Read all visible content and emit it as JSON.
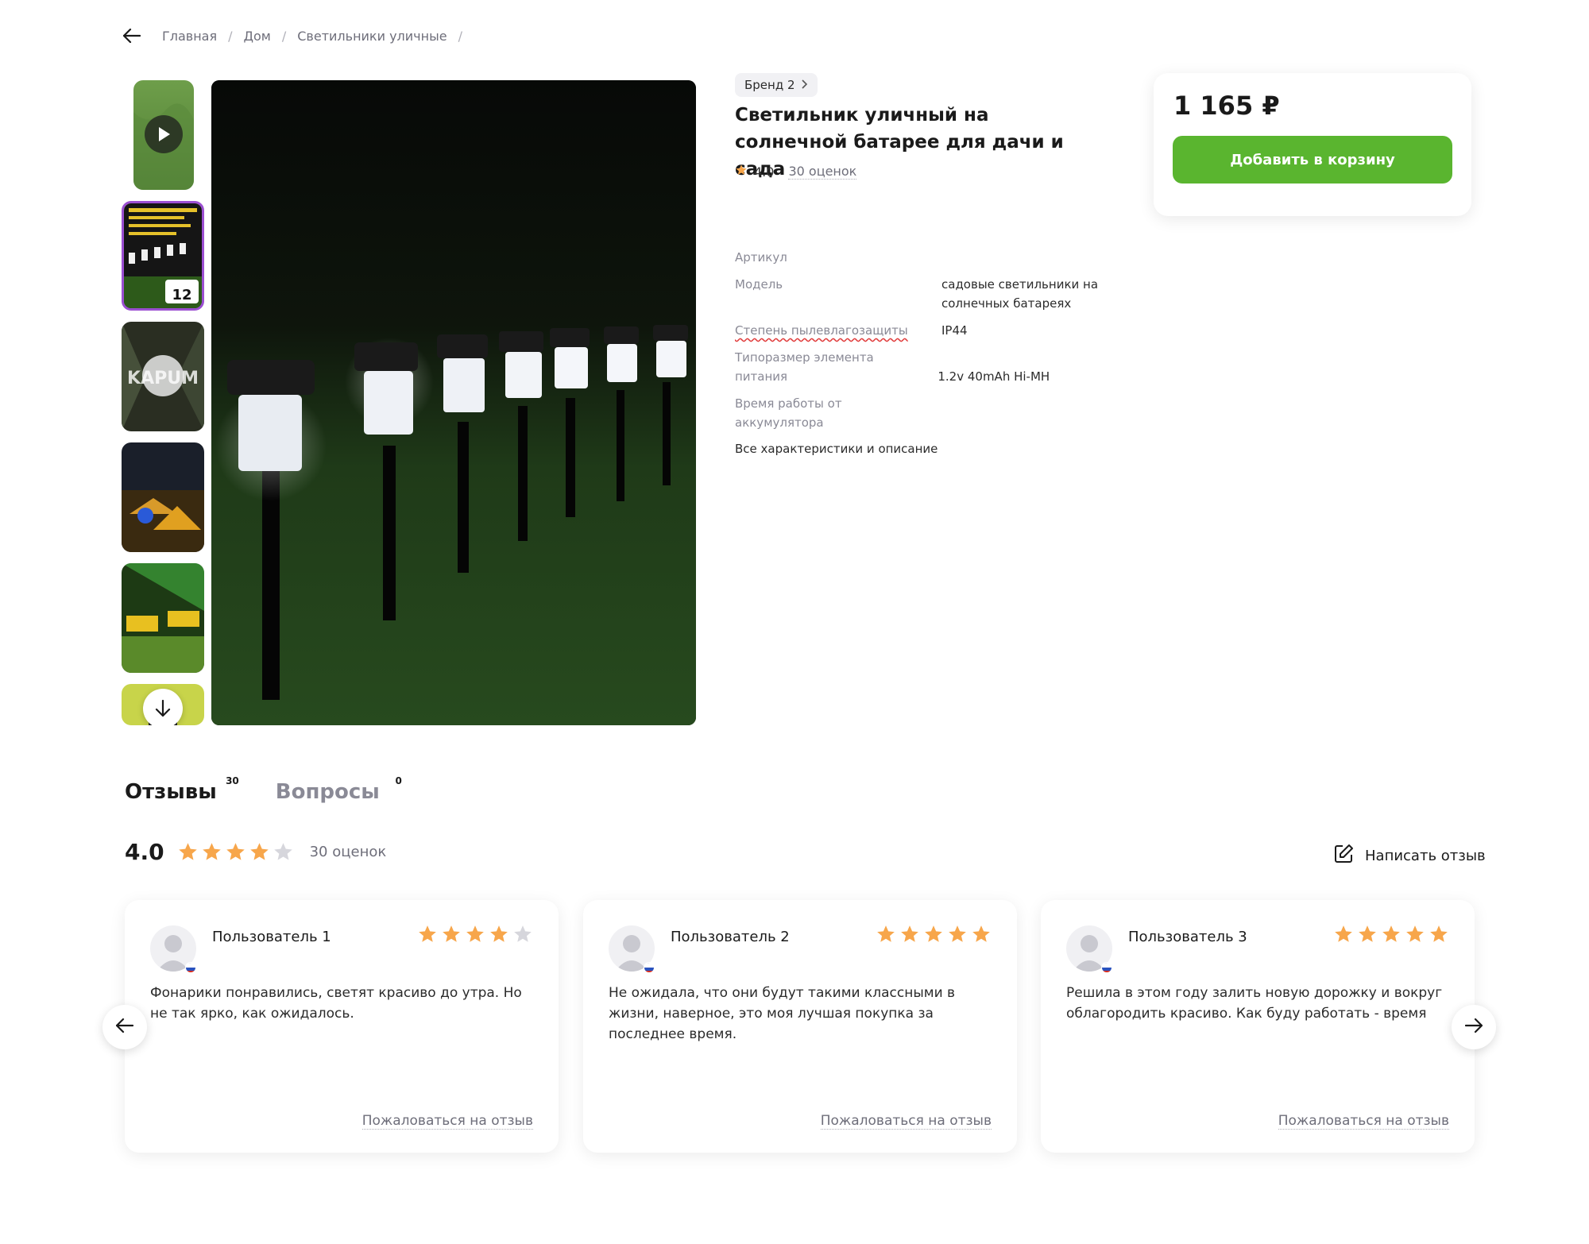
{
  "breadcrumb": {
    "items": [
      "Главная",
      "Дом",
      "Светильники уличные"
    ],
    "separator": "/"
  },
  "product": {
    "brand": "Бренд 2",
    "title": "Светильник уличный на солнечной батарее для дачи и сада",
    "rating": "4.0",
    "rating_count": "30 оценок",
    "specs": [
      {
        "key": "Артикул",
        "value": ""
      },
      {
        "key": "Модель",
        "value": "садовые светильники на солнечных батареях"
      },
      {
        "key": "Степень пылевлагозащиты",
        "value": "IP44"
      },
      {
        "key": "Типоразмер элемента питания",
        "value": "1.2v 40mAh Hi-MH"
      },
      {
        "key": "Время работы от аккумулятора",
        "value": ""
      }
    ],
    "all_specs_link": "Все характеристики и описание",
    "price": "1 165 ₽",
    "add_to_cart": "Добавить в корзину"
  },
  "gallery": {
    "thumb2_text_big": "12",
    "thumb3_watermark": "KAPUM"
  },
  "reviews_section": {
    "tabs": [
      {
        "label": "Отзывы",
        "count": "30"
      },
      {
        "label": "Вопросы",
        "count": "0"
      }
    ],
    "summary_score": "4.0",
    "summary_stars": 4,
    "summary_count": "30 оценок",
    "write_review": "Написать отзыв",
    "reviews": [
      {
        "user": "Пользователь 1",
        "stars": 4,
        "text": "Фонарики понравились, светят красиво до утра. Но не так ярко, как ожидалось.",
        "report": "Пожаловаться на отзыв"
      },
      {
        "user": "Пользователь 2",
        "stars": 5,
        "text": "Не ожидала, что они будут такими классными в жизни, наверное, это моя лучшая покупка за последнее время.",
        "report": "Пожаловаться на отзыв"
      },
      {
        "user": "Пользователь 3",
        "stars": 5,
        "text": "Решила в этом году залить новую дорожку и вокруг облагородить красиво. Как буду работать - время",
        "report": "Пожаловаться на отзыв"
      }
    ]
  },
  "colors": {
    "accent_green": "#5ab52f",
    "star_orange": "#f7a64b",
    "star_grey": "#d6d6dc",
    "thumb_active_border": "#9b4fd1"
  },
  "icons": {
    "back": "arrow-left-icon",
    "play": "play-icon",
    "scroll_down": "arrow-down-icon",
    "brand_chevron": "chevron-right-icon",
    "star": "star-icon",
    "write": "edit-icon",
    "prev": "arrow-left-icon",
    "next": "arrow-right-icon"
  }
}
